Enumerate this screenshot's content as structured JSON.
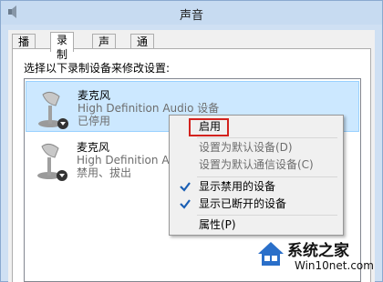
{
  "window": {
    "title": "声音"
  },
  "tabs": [
    {
      "label": "播放"
    },
    {
      "label": "录制"
    },
    {
      "label": "声音"
    },
    {
      "label": "通信"
    }
  ],
  "instruction": "选择以下录制设备来修改设置:",
  "devices": [
    {
      "name": "麦克风",
      "desc": "High Definition Audio 设备",
      "status": "已停用"
    },
    {
      "name": "麦克风",
      "desc": "High Definition Audio 设备",
      "status": "禁用、拔出"
    }
  ],
  "context_menu": {
    "items": [
      {
        "label": "启用"
      },
      {
        "label": "设置为默认设备(D)"
      },
      {
        "label": "设置为默认通信设备(C)"
      },
      {
        "label": "显示禁用的设备"
      },
      {
        "label": "显示已断开的设备"
      },
      {
        "label": "属性(P)"
      }
    ]
  },
  "watermark": {
    "brand": "系统之家",
    "url": "Win10net.com"
  },
  "colors": {
    "selection": "#cce8ff",
    "highlight_box": "#d3221e",
    "check": "#1a5fb4"
  }
}
